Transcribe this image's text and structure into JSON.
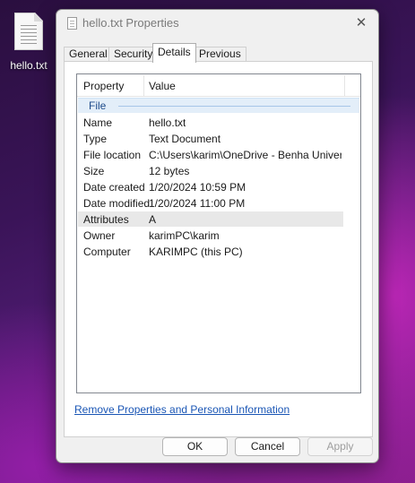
{
  "desktop": {
    "icon_name": "text-file-icon",
    "file_label": "hello.txt"
  },
  "dialog": {
    "title": "hello.txt Properties",
    "close_glyph": "✕",
    "tabs": [
      {
        "label": "General",
        "active": false
      },
      {
        "label": "Security",
        "active": false
      },
      {
        "label": "Details",
        "active": true
      },
      {
        "label": "Previous Versions",
        "active": false
      }
    ],
    "details": {
      "columns": [
        "Property",
        "Value"
      ],
      "group": "File",
      "rows": [
        {
          "name": "Name",
          "value": "hello.txt"
        },
        {
          "name": "Type",
          "value": "Text Document"
        },
        {
          "name": "File location",
          "value": "C:\\Users\\karim\\OneDrive - Benha Universi..."
        },
        {
          "name": "Size",
          "value": "12 bytes"
        },
        {
          "name": "Date created",
          "value": "1/20/2024 10:59 PM"
        },
        {
          "name": "Date modified",
          "value": "1/20/2024 11:00 PM"
        },
        {
          "name": "Attributes",
          "value": "A",
          "selected": true
        },
        {
          "name": "Owner",
          "value": "karimPC\\karim"
        },
        {
          "name": "Computer",
          "value": "KARIMPC (this PC)"
        }
      ]
    },
    "remove_link": "Remove Properties and Personal Information",
    "buttons": {
      "ok": "OK",
      "cancel": "Cancel",
      "apply": "Apply",
      "apply_enabled": false
    }
  }
}
